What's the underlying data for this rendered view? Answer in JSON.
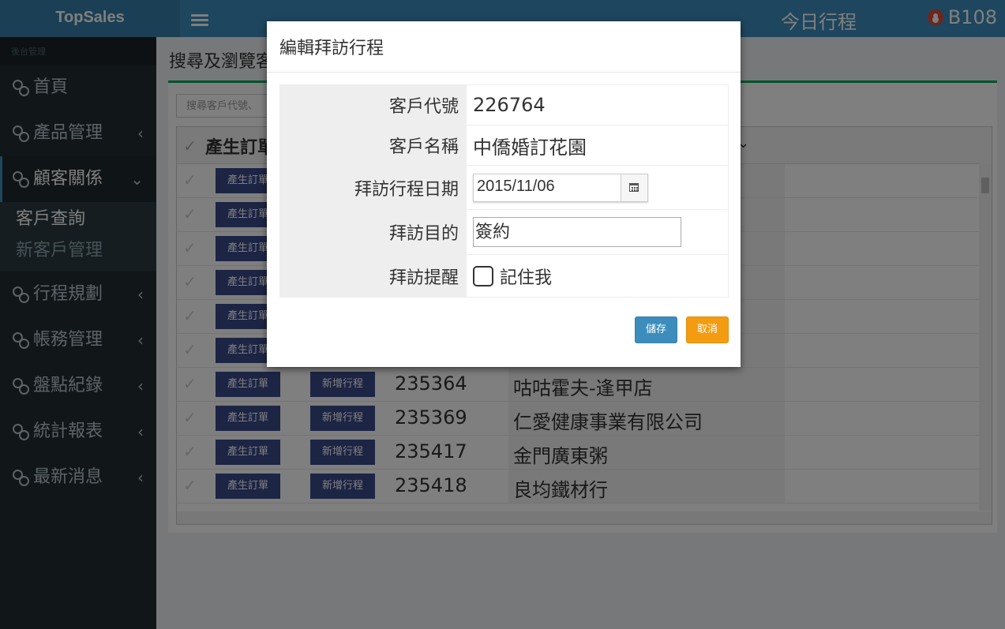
{
  "header": {
    "brand": "TopSales",
    "today_link": "今日行程",
    "user": "B108"
  },
  "sidebar": {
    "heading": "後台管理",
    "items": [
      {
        "label": "首頁"
      },
      {
        "label": "產品管理"
      },
      {
        "label": "顧客關係"
      },
      {
        "label": "行程規劃"
      },
      {
        "label": "帳務管理"
      },
      {
        "label": "盤點紀錄"
      },
      {
        "label": "統計報表"
      },
      {
        "label": "最新消息"
      }
    ],
    "sub": [
      "客戶查詢",
      "新客戶管理"
    ]
  },
  "content": {
    "title": "搜尋及瀏覽客",
    "search_placeholder": "搜尋客戶代號、",
    "grid_header": "產生訂單",
    "btn_order": "產生訂單",
    "btn_schedule": "新增行程",
    "rows": [
      {
        "code": "",
        "name": ""
      },
      {
        "code": "",
        "name": ""
      },
      {
        "code": "",
        "name": ""
      },
      {
        "code": "",
        "name": ""
      },
      {
        "code": "",
        "name": ""
      },
      {
        "code": "",
        "name": ""
      },
      {
        "code": "235364",
        "name": "咕咕霍夫-逢甲店"
      },
      {
        "code": "235369",
        "name": "仁愛健康事業有限公司"
      },
      {
        "code": "235417",
        "name": "金門廣東粥"
      },
      {
        "code": "235418",
        "name": "良均鐵材行"
      }
    ]
  },
  "modal": {
    "title": "編輯拜訪行程",
    "fields": {
      "customer_code_label": "客戶代號",
      "customer_code": "226764",
      "customer_name_label": "客戶名稱",
      "customer_name": "中僑婚訂花園",
      "visit_date_label": "拜訪行程日期",
      "visit_date": "2015/11/06",
      "purpose_label": "拜訪目的",
      "purpose": "簽約",
      "reminder_label": "拜訪提醒",
      "remember_me": "記住我"
    },
    "save": "儲存",
    "cancel": "取消"
  }
}
